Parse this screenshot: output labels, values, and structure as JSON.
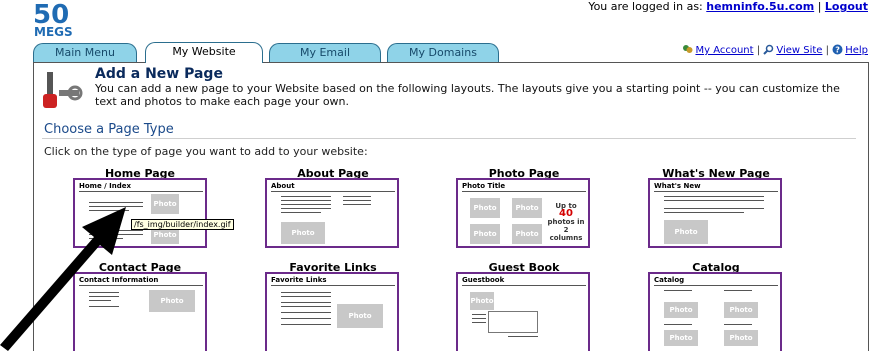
{
  "header": {
    "logo_number": "50",
    "logo_word": "MEGS",
    "login_prefix": "You are logged in as:",
    "username": "hemninfo.5u.com",
    "separator": "|",
    "logout": "Logout"
  },
  "tabs": [
    {
      "label": "Main Menu"
    },
    {
      "label": "My Website"
    },
    {
      "label": "My Email"
    },
    {
      "label": "My Domains"
    }
  ],
  "right_links": {
    "my_account": "My Account",
    "view_site": "View Site",
    "help": "Help",
    "separator": "|"
  },
  "page": {
    "title": "Add a New Page",
    "description": "You can add a new page to your Website based on the following layouts. The layouts give you a starting point -- you can customize the text and photos to make each page your own.",
    "choose_title": "Choose a Page Type",
    "instruction": "Click on the type of page you want to add to your website:"
  },
  "layouts": [
    {
      "label": "Home Page",
      "caption": "Home / Index"
    },
    {
      "label": "About Page",
      "caption": "About"
    },
    {
      "label": "Photo Page",
      "caption": "Photo Title"
    },
    {
      "label": "What's New Page",
      "caption": "What's New"
    },
    {
      "label": "Contact Page",
      "caption": "Contact Information"
    },
    {
      "label": "Favorite Links",
      "caption": "Favorite Links"
    },
    {
      "label": "Guest Book",
      "caption": "Guestbook"
    },
    {
      "label": "Catalog",
      "caption": "Catalog"
    }
  ],
  "thumb_text": {
    "photo": "Photo",
    "up_to": "Up to",
    "count": "40",
    "photos_in": "photos in 2 columns"
  },
  "tooltip": "/fs_img/builder/index.gif",
  "colors": {
    "tab_inactive": "#8fd3e8",
    "thumb_border": "#6b2a8a",
    "link": "#0000cc",
    "title": "#0a2a5c"
  }
}
